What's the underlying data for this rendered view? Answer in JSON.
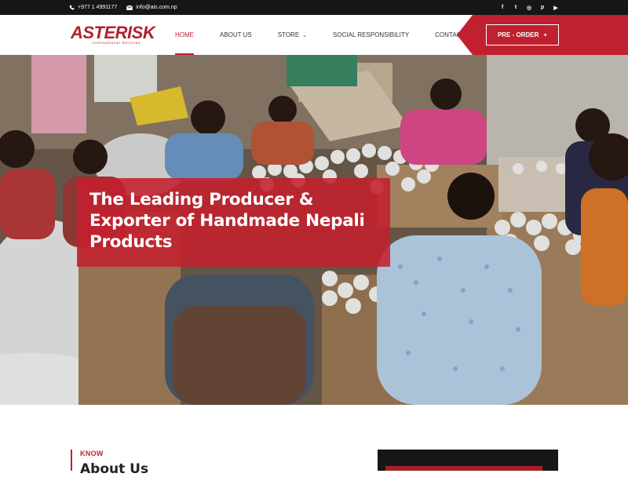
{
  "topbar": {
    "phone": "+977 1 4991177",
    "email": "info@ais.com.np",
    "social": [
      {
        "icon": "facebook-icon",
        "glyph": "f"
      },
      {
        "icon": "twitter-icon",
        "glyph": "t"
      },
      {
        "icon": "instagram-icon",
        "glyph": "◎"
      },
      {
        "icon": "pinterest-icon",
        "glyph": "p"
      },
      {
        "icon": "youtube-icon",
        "glyph": "▶"
      }
    ]
  },
  "brand": {
    "name": "ASTERISK",
    "tagline": "International Services",
    "color": "#c0202f"
  },
  "nav": {
    "items": [
      {
        "label": "HOME",
        "active": true
      },
      {
        "label": "ABOUT US",
        "active": false
      },
      {
        "label": "STORE",
        "active": false,
        "dropdown": true
      },
      {
        "label": "SOCIAL RESPONSIBILITY",
        "active": false
      },
      {
        "label": "CONTACT",
        "active": false
      }
    ],
    "preorder_label": "PRE - ORDER",
    "preorder_icon": "+"
  },
  "hero": {
    "headline": "The Leading Producer & Exporter of Handmade Nepali Products",
    "overlay_color": "#c4202e"
  },
  "about": {
    "eyebrow": "KNOW",
    "title": "About Us"
  }
}
